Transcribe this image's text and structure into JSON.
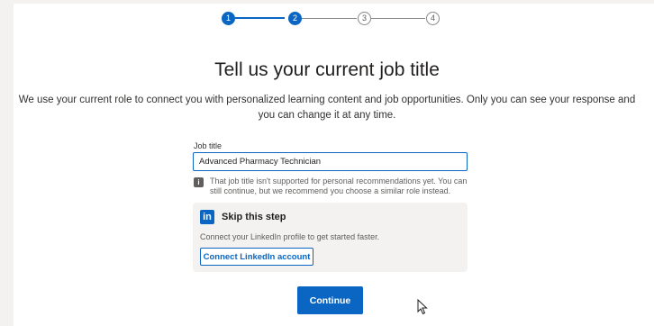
{
  "stepper": {
    "steps": [
      "1",
      "2",
      "3",
      "4"
    ],
    "current": 2
  },
  "main": {
    "title": "Tell us your current job title",
    "subtitle": "We use your current role to connect you with personalized learning content and job opportunities. Only you can see your response and you can change it at any time."
  },
  "form": {
    "job_title_label": "Job title",
    "job_title_value": "Advanced Pharmacy Technician",
    "info_icon": "info-icon",
    "info_message": "That job title isn't supported for personal recommendations yet. You can still continue, but we recommend you choose a similar role instead."
  },
  "skip": {
    "logo_text": "in",
    "heading": "Skip this step",
    "description": "Connect your LinkedIn profile to get started faster.",
    "connect_label": "Connect LinkedIn account"
  },
  "actions": {
    "continue_label": "Continue"
  },
  "colors": {
    "accent": "#0a66c2",
    "background": "#f3f2f1"
  }
}
